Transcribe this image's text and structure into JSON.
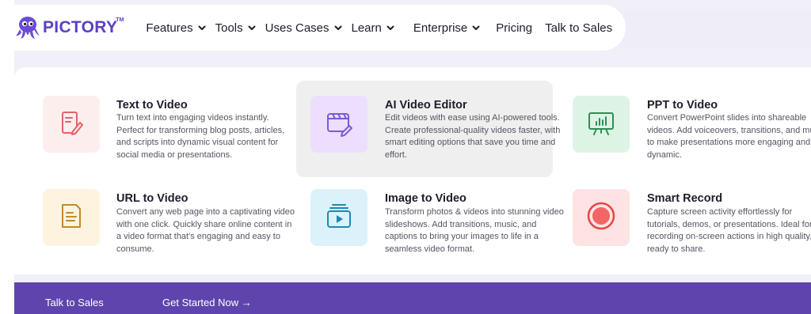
{
  "brand": {
    "name": "PICTORY",
    "trademark": "TM",
    "color": "#5b3fc4"
  },
  "nav": {
    "items": [
      {
        "label": "Features",
        "dropdown": true
      },
      {
        "label": "Tools",
        "dropdown": true
      },
      {
        "label": "Uses Cases",
        "dropdown": true
      },
      {
        "label": "Learn",
        "dropdown": true
      },
      {
        "label": "Enterprise",
        "dropdown": true
      },
      {
        "label": "Pricing",
        "dropdown": false
      },
      {
        "label": "Talk to Sales",
        "dropdown": false
      }
    ]
  },
  "menu": {
    "cards": [
      {
        "title": "Text to Video",
        "icon": "document-pen-icon",
        "tile_color": "#fdeeee",
        "desc": "Turn text into engaging videos instantly. Perfect for transforming blog posts, articles, and scripts into dynamic visual content for social media or presentations."
      },
      {
        "title": "AI Video Editor",
        "icon": "clapper-edit-icon",
        "tile_color": "#ebdffd",
        "desc": "Edit videos with ease using AI-powered tools. Create professional-quality videos faster, with smart editing options that save you time and effort."
      },
      {
        "title": "PPT to Video",
        "icon": "presentation-board-icon",
        "tile_color": "#ddf4e5",
        "desc": "Convert PowerPoint slides into shareable videos. Add voiceovers, transitions, and music to make presentations more engaging and dynamic."
      },
      {
        "title": "URL to Video",
        "icon": "web-page-icon",
        "tile_color": "#fdf3df",
        "desc": "Convert any web page into a captivating video with one click. Quickly share online content in a video format that's engaging and easy to consume."
      },
      {
        "title": "Image to Video",
        "icon": "image-stack-play-icon",
        "tile_color": "#dcf2fb",
        "desc": "Transform photos & videos into stunning video slideshows. Add transitions, music, and captions to bring your images to life in a seamless video format."
      },
      {
        "title": "Smart Record",
        "icon": "record-icon",
        "tile_color": "#fde3e3",
        "desc": "Capture screen activity effortlessly for tutorials, demos, or presentations. Ideal for recording on-screen actions in high quality, ready to share."
      }
    ]
  },
  "footer": {
    "talk": "Talk to Sales",
    "start": "Get Started Now →",
    "color": "#5e45ad"
  }
}
